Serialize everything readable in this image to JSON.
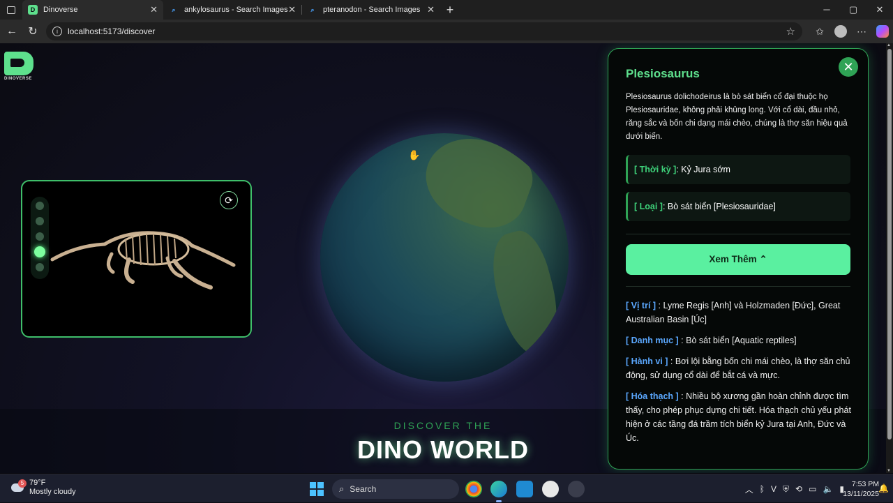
{
  "browser": {
    "tabs": [
      {
        "title": "Dinoverse",
        "favicon": "D",
        "active": true
      },
      {
        "title": "ankylosaurus - Search Images",
        "favicon": "search-icon",
        "active": false
      },
      {
        "title": "pteranodon - Search Images",
        "favicon": "search-icon",
        "active": false
      }
    ],
    "url": "localhost:5173/discover"
  },
  "page": {
    "logo_text": "DINOVERSE",
    "viewer": {
      "dot_count": 5,
      "active_dot": 4
    },
    "headline_small": "DISCOVER THE",
    "headline_big": "DINO WORLD"
  },
  "panel": {
    "name": "Plesiosaurus",
    "description": "Plesiosaurus dolichodeirus là bò sát biển cổ đại thuộc họ Plesiosauridae, không phải khủng long. Với cổ dài, đầu nhỏ, răng sắc và bốn chi dạng mái chèo, chúng là thợ săn hiệu quả dưới biển.",
    "period_label": "[ Thời kỳ ]",
    "period_value": " : Kỷ Jura sớm",
    "type_label": "[ Loại ]",
    "type_value": " : Bò sát biển [Plesiosauridae]",
    "more_button": "Xem Thêm ⌃",
    "details": [
      {
        "label": "[ Vị trí ]",
        "value": " : Lyme Regis [Anh] và Holzmaden [Đức], Great Australian Basin [Úc]"
      },
      {
        "label": "[ Danh mục ]",
        "value": " : Bò sát biển [Aquatic reptiles]"
      },
      {
        "label": "[ Hành vi ]",
        "value": " : Bơi lội bằng bốn chi mái chèo, là thợ săn chủ động, sử dụng cổ dài để bắt cá và mực."
      },
      {
        "label": "[ Hóa thạch ]",
        "value": " : Nhiều bộ xương gần hoàn chỉnh được tìm thấy, cho phép phục dựng chi tiết. Hóa thạch chủ yếu phát hiện ở các tầng đá trầm tích biển kỷ Jura tại Anh, Đức và Úc."
      }
    ]
  },
  "taskbar": {
    "weather_badge": "5",
    "weather_temp": "79°F",
    "weather_desc": "Mostly cloudy",
    "search_label": "Search",
    "time": "7:53 PM",
    "date": "13/11/2025"
  },
  "colors": {
    "accent_green": "#2fa355",
    "bright_green": "#5ee08d",
    "button_green": "#5af0a0",
    "detail_label_blue": "#5ba8ff"
  }
}
